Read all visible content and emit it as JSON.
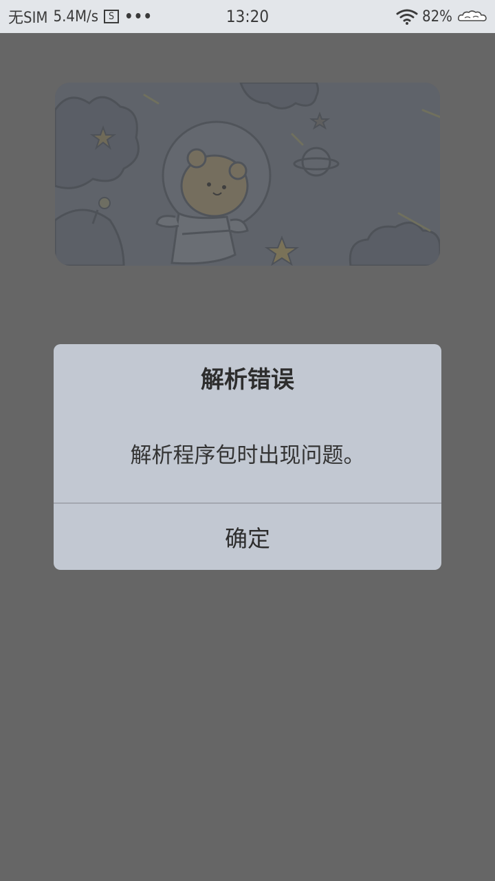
{
  "status_bar": {
    "carrier": "无SIM",
    "net_speed": "5.4M/s",
    "s_icon_label": "S",
    "more_dots": "•••",
    "time": "13:20",
    "battery": "82%"
  },
  "dialog": {
    "title": "解析错误",
    "message": "解析程序包时出现问题。",
    "ok_button": "确定"
  },
  "colors": {
    "scrim_background": "#666666",
    "dialog_background": "#c2c8d2",
    "status_bar_background": "#e3e6ea"
  }
}
